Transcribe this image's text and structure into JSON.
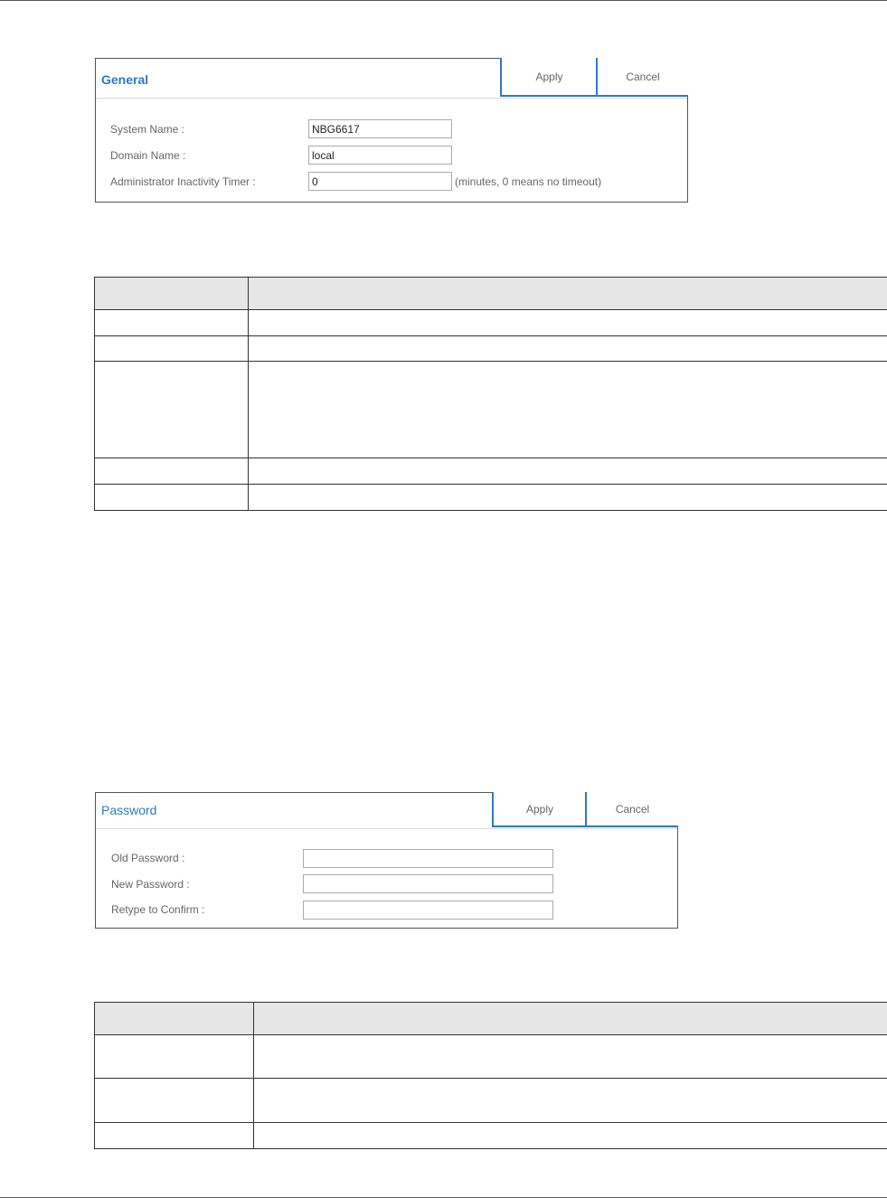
{
  "general_panel": {
    "title": "General",
    "apply_label": "Apply",
    "cancel_label": "Cancel",
    "fields": [
      {
        "label": "System Name :",
        "value": "NBG6617"
      },
      {
        "label": "Domain Name :",
        "value": "local"
      },
      {
        "label": "Administrator Inactivity Timer :",
        "value": "0",
        "hint": "(minutes, 0 means no timeout)"
      }
    ]
  },
  "password_panel": {
    "title": "Password",
    "apply_label": "Apply",
    "cancel_label": "Cancel",
    "fields": [
      {
        "label": "Old Password :",
        "value": ""
      },
      {
        "label": "New Password :",
        "value": ""
      },
      {
        "label": "Retype to Confirm :",
        "value": ""
      }
    ]
  }
}
